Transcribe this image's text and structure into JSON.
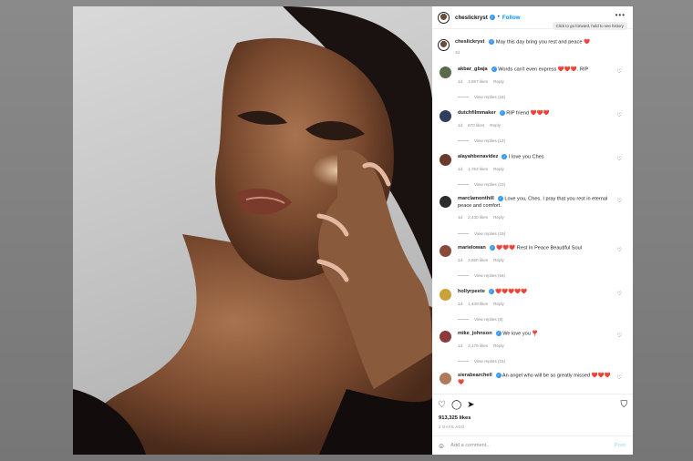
{
  "post": {
    "username": "cheslickryst",
    "follow_label": "Follow",
    "more_icon": "•••",
    "tooltip": "Click to go forward, hold to see history",
    "caption": {
      "username": "cheslickryst",
      "text": "May this day bring you rest and peace ❤️",
      "age": "2d"
    }
  },
  "comments": [
    {
      "username": "akbar_gbaja",
      "text": "Words can't even express ❤️❤️❤️. RIP",
      "age": "1d",
      "likes": "3,867 likes",
      "reply": "Reply",
      "view_replies": "View replies (18)"
    },
    {
      "username": "dutchfilmmaker",
      "text": "RIP friend ❤️❤️❤️",
      "age": "1d",
      "likes": "670 likes",
      "reply": "Reply",
      "view_replies": "View replies (12)"
    },
    {
      "username": "alayahbenavidez",
      "text": "I love you Ches",
      "age": "1d",
      "likes": "1,763 likes",
      "reply": "Reply",
      "view_replies": "View replies (23)"
    },
    {
      "username": "marclamonthill",
      "text": "Love you, Ches. I pray that you rest in eternal peace and comfort.",
      "age": "1d",
      "likes": "2,430 likes",
      "reply": "Reply",
      "view_replies": "View replies (19)"
    },
    {
      "username": "marielowan",
      "text": "❤️❤️❤️ Rest In Peace Beautiful Soul",
      "age": "1d",
      "likes": "3,860 likes",
      "reply": "Reply",
      "view_replies": "View replies (64)"
    },
    {
      "username": "hollyrpeete",
      "text": "❤️❤️❤️❤️❤️",
      "age": "1d",
      "likes": "1,449 likes",
      "reply": "Reply",
      "view_replies": "View replies (8)"
    },
    {
      "username": "mike_johnson",
      "text": "We love you ❣️",
      "age": "1d",
      "likes": "3,179 likes",
      "reply": "Reply",
      "view_replies": "View replies (15)"
    },
    {
      "username": "sierabearchell",
      "text": "An angel who will be so greatly missed ❤️❤️❤️❤️",
      "age": "",
      "likes": "",
      "reply": "",
      "view_replies": ""
    }
  ],
  "footer": {
    "likes": "913,325 likes",
    "ago": "2 DAYS AGO",
    "add_comment_placeholder": "Add a comment...",
    "post_label": "Post",
    "icons": [
      "heart-icon",
      "comment-icon",
      "share-icon",
      "bookmark-icon"
    ]
  },
  "colors": {
    "accent": "#0095f6",
    "verified": "#3897f0",
    "heart": "#e0245e"
  }
}
